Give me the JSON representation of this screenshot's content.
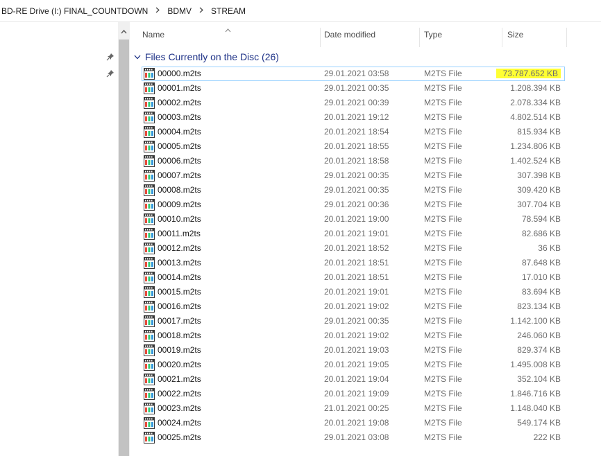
{
  "breadcrumb": [
    "BD-RE Drive (I:) FINAL_COUNTDOWN",
    "BDMV",
    "STREAM"
  ],
  "columns": {
    "name": "Name",
    "date": "Date modified",
    "type": "Type",
    "size": "Size"
  },
  "group": {
    "title": "Files Currently on the Disc (26)"
  },
  "files": [
    {
      "name": "00000.m2ts",
      "date": "29.01.2021 03:58",
      "type": "M2TS File",
      "size": "73.787.652 KB"
    },
    {
      "name": "00001.m2ts",
      "date": "29.01.2021 00:35",
      "type": "M2TS File",
      "size": "1.208.394 KB"
    },
    {
      "name": "00002.m2ts",
      "date": "29.01.2021 00:39",
      "type": "M2TS File",
      "size": "2.078.334 KB"
    },
    {
      "name": "00003.m2ts",
      "date": "20.01.2021 19:12",
      "type": "M2TS File",
      "size": "4.802.514 KB"
    },
    {
      "name": "00004.m2ts",
      "date": "20.01.2021 18:54",
      "type": "M2TS File",
      "size": "815.934 KB"
    },
    {
      "name": "00005.m2ts",
      "date": "20.01.2021 18:55",
      "type": "M2TS File",
      "size": "1.234.806 KB"
    },
    {
      "name": "00006.m2ts",
      "date": "20.01.2021 18:58",
      "type": "M2TS File",
      "size": "1.402.524 KB"
    },
    {
      "name": "00007.m2ts",
      "date": "29.01.2021 00:35",
      "type": "M2TS File",
      "size": "307.398 KB"
    },
    {
      "name": "00008.m2ts",
      "date": "29.01.2021 00:35",
      "type": "M2TS File",
      "size": "309.420 KB"
    },
    {
      "name": "00009.m2ts",
      "date": "29.01.2021 00:36",
      "type": "M2TS File",
      "size": "307.704 KB"
    },
    {
      "name": "00010.m2ts",
      "date": "20.01.2021 19:00",
      "type": "M2TS File",
      "size": "78.594 KB"
    },
    {
      "name": "00011.m2ts",
      "date": "20.01.2021 19:01",
      "type": "M2TS File",
      "size": "82.686 KB"
    },
    {
      "name": "00012.m2ts",
      "date": "20.01.2021 18:52",
      "type": "M2TS File",
      "size": "36 KB"
    },
    {
      "name": "00013.m2ts",
      "date": "20.01.2021 18:51",
      "type": "M2TS File",
      "size": "87.648 KB"
    },
    {
      "name": "00014.m2ts",
      "date": "20.01.2021 18:51",
      "type": "M2TS File",
      "size": "17.010 KB"
    },
    {
      "name": "00015.m2ts",
      "date": "20.01.2021 19:01",
      "type": "M2TS File",
      "size": "83.694 KB"
    },
    {
      "name": "00016.m2ts",
      "date": "20.01.2021 19:02",
      "type": "M2TS File",
      "size": "823.134 KB"
    },
    {
      "name": "00017.m2ts",
      "date": "29.01.2021 00:35",
      "type": "M2TS File",
      "size": "1.142.100 KB"
    },
    {
      "name": "00018.m2ts",
      "date": "20.01.2021 19:02",
      "type": "M2TS File",
      "size": "246.060 KB"
    },
    {
      "name": "00019.m2ts",
      "date": "20.01.2021 19:03",
      "type": "M2TS File",
      "size": "829.374 KB"
    },
    {
      "name": "00020.m2ts",
      "date": "20.01.2021 19:05",
      "type": "M2TS File",
      "size": "1.495.008 KB"
    },
    {
      "name": "00021.m2ts",
      "date": "20.01.2021 19:04",
      "type": "M2TS File",
      "size": "352.104 KB"
    },
    {
      "name": "00022.m2ts",
      "date": "20.01.2021 19:09",
      "type": "M2TS File",
      "size": "1.846.716 KB"
    },
    {
      "name": "00023.m2ts",
      "date": "21.01.2021 00:25",
      "type": "M2TS File",
      "size": "1.148.040 KB"
    },
    {
      "name": "00024.m2ts",
      "date": "20.01.2021 19:08",
      "type": "M2TS File",
      "size": "549.174 KB"
    },
    {
      "name": "00025.m2ts",
      "date": "29.01.2021 03:08",
      "type": "M2TS File",
      "size": "222 KB"
    }
  ],
  "colors": {
    "highlight": "#ffff33",
    "selection_border": "#99d1ff",
    "group_text": "#1e3287",
    "scroll_thumb": "#c2c2c2"
  },
  "icons": {
    "file": "m2ts-file-icon",
    "pin": "pin-icon",
    "breadcrumb_separator": "chevron-right-icon",
    "group_toggle": "chevron-down-icon",
    "sort": "chevron-up-icon"
  }
}
